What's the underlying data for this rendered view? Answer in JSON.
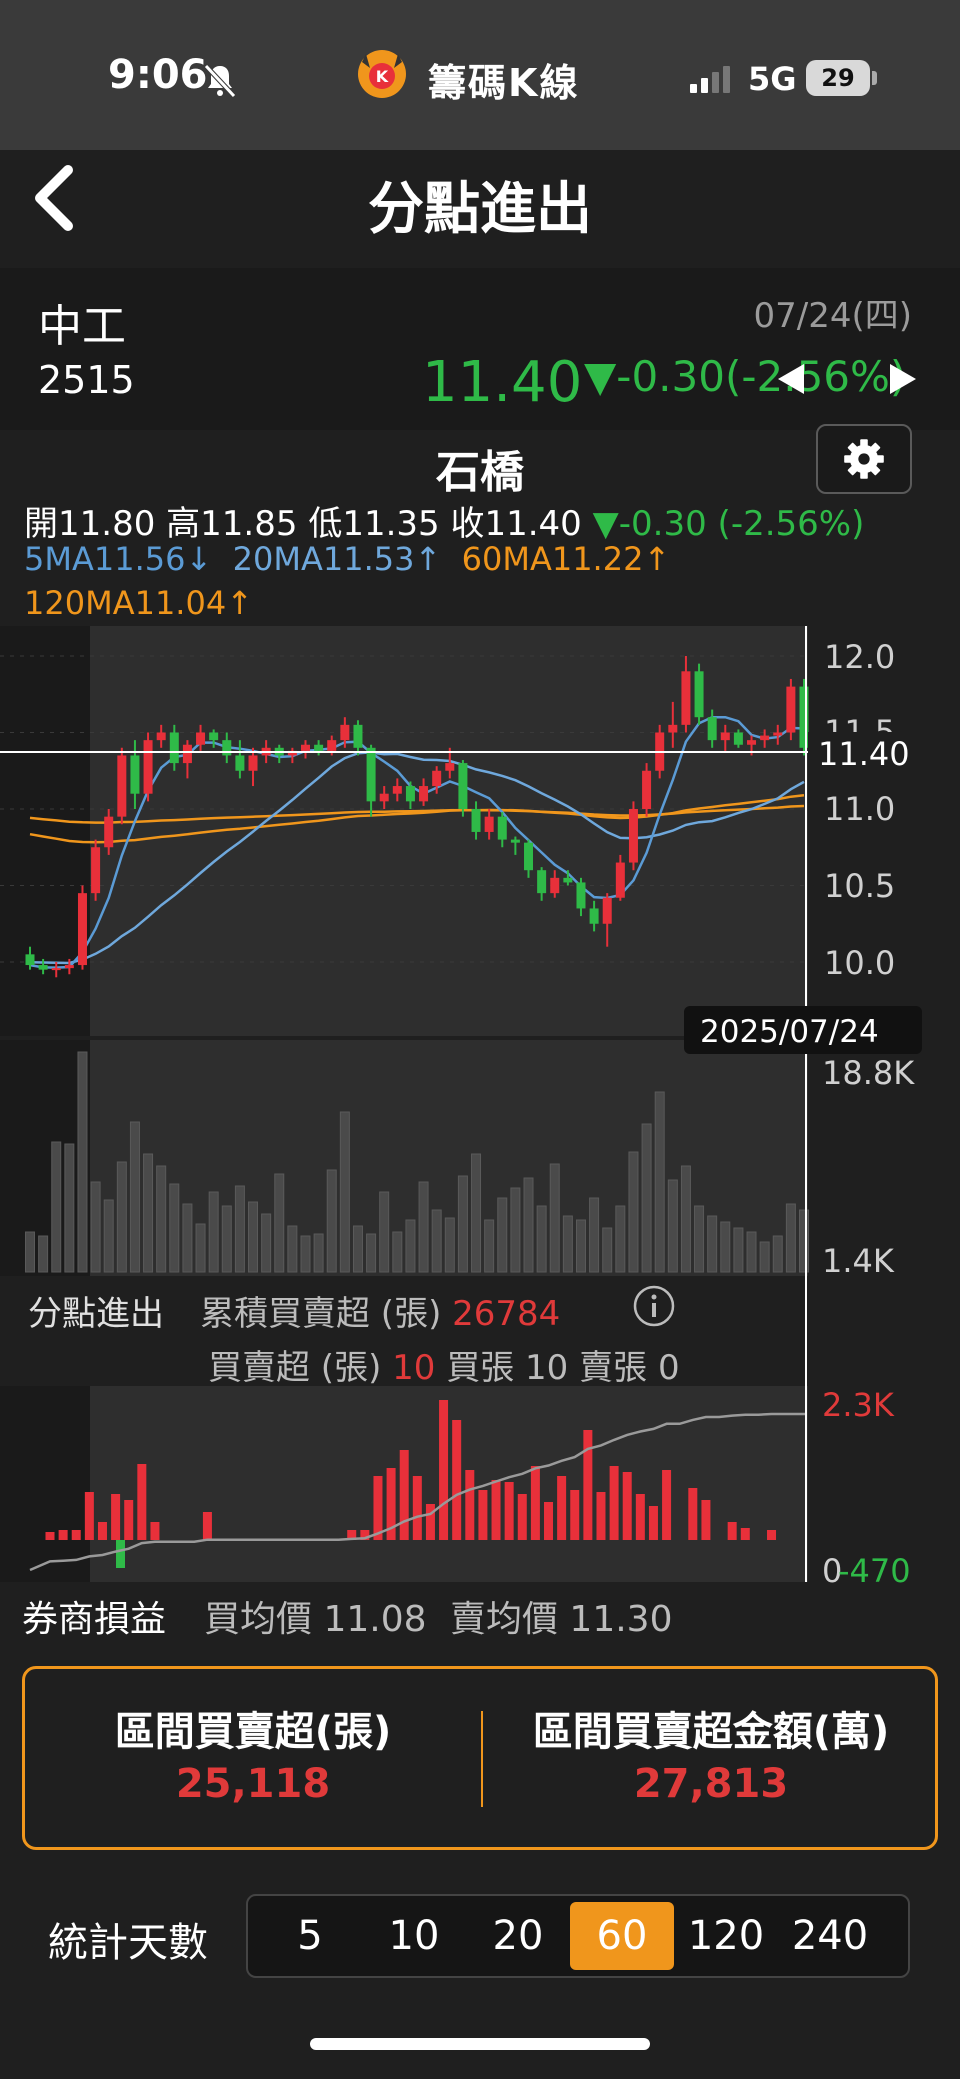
{
  "status_bar": {
    "time": "9:06",
    "app_name": "籌碼K線",
    "network": "5G",
    "battery": "29"
  },
  "nav": {
    "title": "分點進出"
  },
  "quote": {
    "name": "中工",
    "code": "2515",
    "date": "07/24(四)",
    "price": "11.40",
    "change": "▼-0.30(-2.56%)"
  },
  "chart": {
    "broker": "石橋",
    "ohlc": {
      "open_label": "開",
      "open": "11.80",
      "high_label": "高",
      "high": "11.85",
      "low_label": "低",
      "low": "11.35",
      "close_label": "收",
      "close": "11.40",
      "change": "▼-0.30 (-2.56%)"
    },
    "ma": {
      "ma5": "5MA11.56↓",
      "ma20": "20MA11.53↑",
      "ma60": "60MA11.22↑",
      "ma120": "120MA11.04↑"
    },
    "price_axis": [
      "12.0",
      "11.5",
      "11.0",
      "10.5",
      "10.0"
    ],
    "crosshair_price": "11.40",
    "crosshair_date": "2025/07/24",
    "volume_axis": [
      "18.8K",
      "1.4K"
    ],
    "net_axis": [
      "2.3K",
      "0",
      "-470"
    ],
    "colors": {
      "up": "#e8303a",
      "down": "#2fba48",
      "ma5": "#5b9bd5",
      "ma20": "#6fa8dc",
      "ma60": "#f0961c",
      "ma120": "#f0961c",
      "accent": "#f0961c"
    }
  },
  "net_section": {
    "title": "分點進出",
    "cum_label": "累積買賣超 (張)",
    "cum_value": "26784",
    "net_label": "買賣超 (張)",
    "net_value": "10",
    "buy_label": "買張",
    "buy_value": "10",
    "sell_label": "賣張",
    "sell_value": "0"
  },
  "pl_section": {
    "title": "券商損益",
    "buy_avg": "買均價 11.08",
    "sell_avg": "賣均價 11.30"
  },
  "summary": {
    "left_label": "區間買賣超(張)",
    "left_value": "25,118",
    "right_label": "區間買賣超金額(萬)",
    "right_value": "27,813"
  },
  "days": {
    "label": "統計天數",
    "options": [
      "5",
      "10",
      "20",
      "60",
      "120",
      "240"
    ],
    "selected": "60"
  },
  "chart_data": {
    "type": "candlestick",
    "price_ylim": [
      9.8,
      12.2
    ],
    "ohlc": [
      [
        10.05,
        10.1,
        9.95,
        9.98
      ],
      [
        9.98,
        10.02,
        9.92,
        9.95
      ],
      [
        9.95,
        10.0,
        9.9,
        9.96
      ],
      [
        9.96,
        10.02,
        9.92,
        9.98
      ],
      [
        9.98,
        10.5,
        9.95,
        10.45
      ],
      [
        10.45,
        10.8,
        10.4,
        10.75
      ],
      [
        10.75,
        11.0,
        10.7,
        10.95
      ],
      [
        10.95,
        11.4,
        10.9,
        11.35
      ],
      [
        11.35,
        11.45,
        11.0,
        11.1
      ],
      [
        11.1,
        11.5,
        11.05,
        11.45
      ],
      [
        11.45,
        11.55,
        11.4,
        11.5
      ],
      [
        11.5,
        11.55,
        11.25,
        11.3
      ],
      [
        11.3,
        11.45,
        11.2,
        11.42
      ],
      [
        11.42,
        11.55,
        11.38,
        11.5
      ],
      [
        11.5,
        11.52,
        11.4,
        11.45
      ],
      [
        11.45,
        11.5,
        11.3,
        11.35
      ],
      [
        11.35,
        11.45,
        11.2,
        11.25
      ],
      [
        11.25,
        11.4,
        11.15,
        11.35
      ],
      [
        11.35,
        11.45,
        11.3,
        11.4
      ],
      [
        11.4,
        11.42,
        11.3,
        11.35
      ],
      [
        11.35,
        11.4,
        11.3,
        11.38
      ],
      [
        11.38,
        11.45,
        11.33,
        11.42
      ],
      [
        11.42,
        11.45,
        11.35,
        11.38
      ],
      [
        11.38,
        11.48,
        11.35,
        11.45
      ],
      [
        11.45,
        11.6,
        11.4,
        11.55
      ],
      [
        11.55,
        11.58,
        11.35,
        11.4
      ],
      [
        11.4,
        11.42,
        10.95,
        11.05
      ],
      [
        11.05,
        11.15,
        11.0,
        11.1
      ],
      [
        11.1,
        11.2,
        11.05,
        11.15
      ],
      [
        11.15,
        11.18,
        11.0,
        11.05
      ],
      [
        11.05,
        11.2,
        11.02,
        11.15
      ],
      [
        11.15,
        11.28,
        11.1,
        11.25
      ],
      [
        11.25,
        11.4,
        11.2,
        11.3
      ],
      [
        11.3,
        11.32,
        10.95,
        11.0
      ],
      [
        11.0,
        11.05,
        10.8,
        10.85
      ],
      [
        10.85,
        11.0,
        10.8,
        10.95
      ],
      [
        10.95,
        10.98,
        10.75,
        10.8
      ],
      [
        10.8,
        10.82,
        10.7,
        10.78
      ],
      [
        10.78,
        10.8,
        10.55,
        10.6
      ],
      [
        10.6,
        10.62,
        10.4,
        10.45
      ],
      [
        10.45,
        10.6,
        10.42,
        10.55
      ],
      [
        10.55,
        10.6,
        10.5,
        10.52
      ],
      [
        10.52,
        10.55,
        10.3,
        10.35
      ],
      [
        10.35,
        10.4,
        10.2,
        10.25
      ],
      [
        10.25,
        10.45,
        10.1,
        10.42
      ],
      [
        10.42,
        10.7,
        10.4,
        10.65
      ],
      [
        10.65,
        11.05,
        10.6,
        11.0
      ],
      [
        11.0,
        11.3,
        10.95,
        11.25
      ],
      [
        11.25,
        11.55,
        11.2,
        11.5
      ],
      [
        11.5,
        11.7,
        11.4,
        11.55
      ],
      [
        11.55,
        12.0,
        11.5,
        11.9
      ],
      [
        11.9,
        11.95,
        11.55,
        11.6
      ],
      [
        11.6,
        11.65,
        11.4,
        11.45
      ],
      [
        11.45,
        11.55,
        11.38,
        11.5
      ],
      [
        11.5,
        11.52,
        11.4,
        11.42
      ],
      [
        11.42,
        11.48,
        11.35,
        11.45
      ],
      [
        11.45,
        11.52,
        11.4,
        11.48
      ],
      [
        11.48,
        11.55,
        11.42,
        11.5
      ],
      [
        11.5,
        11.85,
        11.45,
        11.8
      ],
      [
        11.8,
        11.85,
        11.35,
        11.4
      ]
    ]
  }
}
